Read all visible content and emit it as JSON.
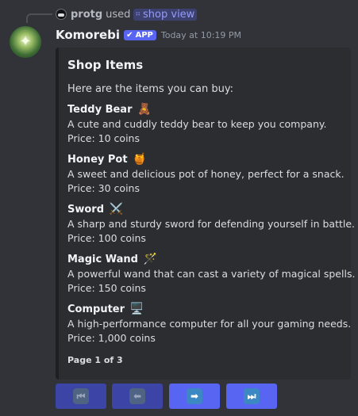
{
  "reply": {
    "user": "protg",
    "used_text": "used",
    "command": "shop view"
  },
  "author": {
    "name": "Komorebi",
    "badge": "APP",
    "timestamp": "Today at 10:19 PM"
  },
  "embed": {
    "title": "Shop Items",
    "intro": "Here are the items you can buy:",
    "items": [
      {
        "name": "Teddy Bear",
        "emoji": "🧸",
        "description": "A cute and cuddly teddy bear to keep you company.",
        "price": "Price: 10 coins"
      },
      {
        "name": "Honey Pot",
        "emoji": "🍯",
        "description": "A sweet and delicious pot of honey, perfect for a snack.",
        "price": "Price: 30 coins"
      },
      {
        "name": "Sword",
        "emoji": "⚔️",
        "description": "A sharp and sturdy sword for defending yourself in battle.",
        "price": "Price: 100 coins"
      },
      {
        "name": "Magic Wand",
        "emoji": "🪄",
        "description": "A powerful wand that can cast a variety of magical spells.",
        "price": "Price: 150 coins"
      },
      {
        "name": "Computer",
        "emoji": "🖥️",
        "description": "A high-performance computer for all your gaming needs.",
        "price": "Price: 1,000 coins"
      }
    ],
    "footer": "Page 1 of 3"
  },
  "buttons": [
    {
      "icon": "first-page-icon",
      "glyph": "⏮",
      "enabled": false
    },
    {
      "icon": "previous-page-icon",
      "glyph": "⬅",
      "enabled": false
    },
    {
      "icon": "next-page-icon",
      "glyph": "➡",
      "enabled": true
    },
    {
      "icon": "last-page-icon",
      "glyph": "⏭",
      "enabled": true
    }
  ],
  "colors": {
    "background": "#313338",
    "embed_background": "#2b2d31",
    "accent": "#5865f2",
    "command_link": "#949cf7"
  }
}
